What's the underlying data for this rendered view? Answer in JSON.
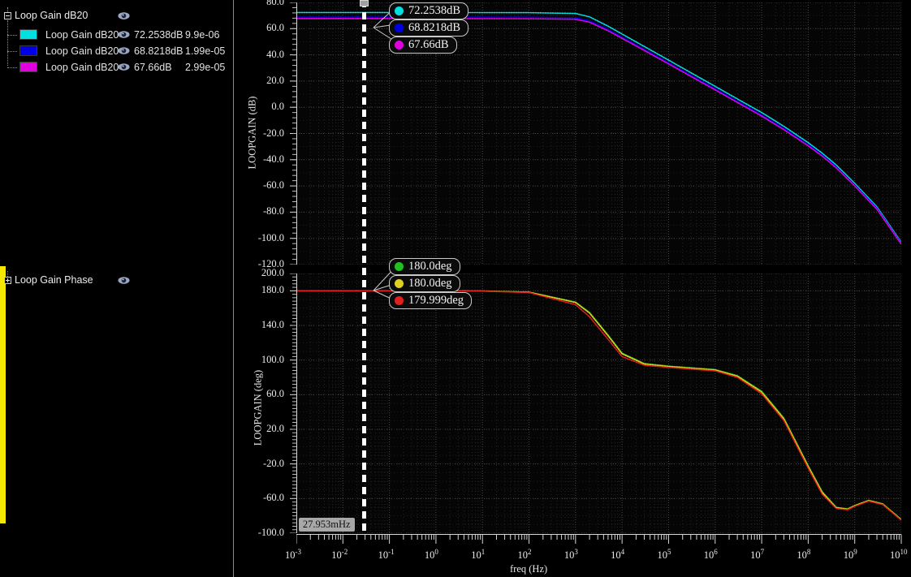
{
  "panel": {
    "groups": [
      {
        "title": "Loop Gain dB20",
        "expander": "minus",
        "visibility_icon": "eye-icon",
        "children": [
          {
            "color": "#00e0e0",
            "name": "Loop Gain dB20",
            "value": "72.2538dB",
            "freq": "9.9e-06",
            "visibility_icon": "eye-icon"
          },
          {
            "color": "#0000e6",
            "name": "Loop Gain dB20",
            "value": "68.8218dB",
            "freq": "1.99e-05",
            "visibility_icon": "eye-icon"
          },
          {
            "color": "#e000e0",
            "name": "Loop Gain dB20",
            "value": "67.66dB",
            "freq": "2.99e-05",
            "visibility_icon": "eye-icon"
          }
        ]
      },
      {
        "title": "Loop Gain Phase",
        "expander": "plus",
        "visibility_icon": "eye-icon",
        "children": []
      }
    ]
  },
  "cursor": {
    "readout": "27.953mHz",
    "freq_hz": 0.027953
  },
  "chart_data": [
    {
      "type": "line",
      "title": "Loop Gain dB20",
      "xlabel": "freq (Hz)",
      "ylabel": "LOOPGAIN (dB)",
      "xscale": "log",
      "xlim": [
        0.001,
        10000000000
      ],
      "ylim": [
        -120.0,
        80.0
      ],
      "ytick_labels": [
        "80.0",
        "60.0",
        "40.0",
        "20.0",
        "0.0",
        "-20.0",
        "-40.0",
        "-60.0",
        "-80.0",
        "-100.0",
        "-120.0"
      ],
      "ytick_values": [
        80,
        60,
        40,
        20,
        0,
        -20,
        -40,
        -60,
        -80,
        -100,
        -120
      ],
      "xtick_exponents": [
        -3,
        -2,
        -1,
        0,
        1,
        2,
        3,
        4,
        5,
        6,
        7,
        8,
        9,
        10
      ],
      "grid": true,
      "legend": "none",
      "series": [
        {
          "name": "Loop Gain dB20",
          "color": "#00e0e0",
          "cursor_value": "72.2538dB",
          "x": [
            0.001,
            0.01,
            0.1,
            1,
            10,
            100,
            1000,
            2000,
            5000,
            10000,
            30000,
            100000,
            300000,
            1000000,
            3000000,
            10000000,
            30000000,
            100000000,
            200000000,
            400000000,
            1000000000,
            3000000000,
            10000000000
          ],
          "y": [
            72.3,
            72.3,
            72.3,
            72.3,
            72.25,
            72.2,
            71.6,
            69.0,
            61.9,
            55.9,
            46.4,
            36.0,
            26.4,
            16.0,
            6.4,
            -4.0,
            -14.5,
            -27.0,
            -35.0,
            -44.0,
            -58.0,
            -76.0,
            -103.0
          ]
        },
        {
          "name": "Loop Gain dB20",
          "color": "#0000e6",
          "cursor_value": "68.8218dB",
          "x": [
            0.001,
            0.01,
            0.1,
            1,
            10,
            100,
            1000,
            2000,
            5000,
            10000,
            30000,
            100000,
            300000,
            1000000,
            3000000,
            10000000,
            30000000,
            100000000,
            200000000,
            400000000,
            1000000000,
            3000000000,
            10000000000
          ],
          "y": [
            68.8,
            68.8,
            68.8,
            68.8,
            68.8,
            68.75,
            68.3,
            66.0,
            59.4,
            53.6,
            44.3,
            34.0,
            24.5,
            14.2,
            4.6,
            -5.8,
            -16.2,
            -28.6,
            -36.4,
            -45.4,
            -59.2,
            -77.0,
            -103.8
          ]
        },
        {
          "name": "Loop Gain dB20",
          "color": "#e000e0",
          "cursor_value": "67.66dB",
          "x": [
            0.001,
            0.01,
            0.1,
            1,
            10,
            100,
            1000,
            2000,
            5000,
            10000,
            30000,
            100000,
            300000,
            1000000,
            3000000,
            10000000,
            30000000,
            100000000,
            200000000,
            400000000,
            1000000000,
            3000000000,
            10000000000
          ],
          "y": [
            67.7,
            67.7,
            67.7,
            67.7,
            67.65,
            67.6,
            67.2,
            64.9,
            58.4,
            52.6,
            43.4,
            33.1,
            23.6,
            13.3,
            3.7,
            -6.7,
            -17.1,
            -29.4,
            -37.2,
            -46.2,
            -60.0,
            -77.8,
            -104.4
          ]
        }
      ],
      "cursor_callouts": [
        {
          "color": "#00e0e0",
          "label": "72.2538dB"
        },
        {
          "color": "#0000e6",
          "label": "68.8218dB"
        },
        {
          "color": "#e000e0",
          "label": "67.66dB"
        }
      ]
    },
    {
      "type": "line",
      "title": "Loop Gain Phase",
      "xlabel": "freq (Hz)",
      "ylabel": "LOOPGAIN (deg)",
      "xscale": "log",
      "xlim": [
        0.001,
        10000000000
      ],
      "ylim": [
        -100.0,
        200.0
      ],
      "ytick_labels": [
        "200.0",
        "180.0",
        "140.0",
        "100.0",
        "60.0",
        "20.0",
        "-20.0",
        "-60.0",
        "-100.0"
      ],
      "ytick_values": [
        200,
        180,
        140,
        100,
        60,
        20,
        -20,
        -60,
        -100
      ],
      "xtick_exponents": [
        -3,
        -2,
        -1,
        0,
        1,
        2,
        3,
        4,
        5,
        6,
        7,
        8,
        9,
        10
      ],
      "grid": true,
      "legend": "none",
      "series": [
        {
          "name": "Loop Gain Phase",
          "color": "#20c020",
          "cursor_value": "180.0deg",
          "x": [
            0.001,
            0.01,
            0.1,
            1,
            10,
            100,
            1000,
            2000,
            5000,
            10000,
            30000,
            100000,
            1000000,
            3000000,
            10000000,
            30000000,
            100000000,
            200000000,
            400000000,
            700000000,
            1000000000,
            2000000000,
            4000000000,
            10000000000
          ],
          "y": [
            180.0,
            180.0,
            180.0,
            180.0,
            179.8,
            178.5,
            167.0,
            155.0,
            129.0,
            108.0,
            96.0,
            93.0,
            89.0,
            82.0,
            64.0,
            33.0,
            -22.0,
            -52.0,
            -70.0,
            -72.0,
            -68.0,
            -62.0,
            -66.0,
            -84.0
          ]
        },
        {
          "name": "Loop Gain Phase",
          "color": "#e0d020",
          "cursor_value": "180.0deg",
          "x": [
            0.001,
            0.01,
            0.1,
            1,
            10,
            100,
            1000,
            2000,
            5000,
            10000,
            30000,
            100000,
            1000000,
            3000000,
            10000000,
            30000000,
            100000000,
            200000000,
            400000000,
            700000000,
            1000000000,
            2000000000,
            4000000000,
            10000000000
          ],
          "y": [
            180.0,
            180.0,
            180.0,
            180.0,
            179.8,
            178.4,
            166.5,
            154.2,
            128.0,
            107.2,
            95.4,
            92.5,
            88.5,
            81.3,
            63.0,
            32.0,
            -23.0,
            -53.0,
            -70.5,
            -72.3,
            -68.2,
            -62.3,
            -66.4,
            -84.4
          ]
        },
        {
          "name": "Loop Gain Phase",
          "color": "#e02020",
          "cursor_value": "179.999deg",
          "x": [
            0.001,
            0.01,
            0.1,
            1,
            10,
            100,
            1000,
            2000,
            5000,
            10000,
            30000,
            100000,
            1000000,
            3000000,
            10000000,
            30000000,
            100000000,
            200000000,
            400000000,
            700000000,
            1000000000,
            2000000000,
            4000000000,
            10000000000
          ],
          "y": [
            179.999,
            179.999,
            179.99,
            179.9,
            179.6,
            178.0,
            164.0,
            150.0,
            124.0,
            104.0,
            94.0,
            91.5,
            87.5,
            80.0,
            61.0,
            30.0,
            -25.0,
            -55.0,
            -71.5,
            -73.0,
            -69.0,
            -63.0,
            -67.0,
            -85.0
          ]
        }
      ],
      "cursor_callouts": [
        {
          "color": "#20c020",
          "label": "180.0deg"
        },
        {
          "color": "#e0d020",
          "label": "180.0deg"
        },
        {
          "color": "#e02020",
          "label": "179.999deg"
        }
      ]
    }
  ]
}
